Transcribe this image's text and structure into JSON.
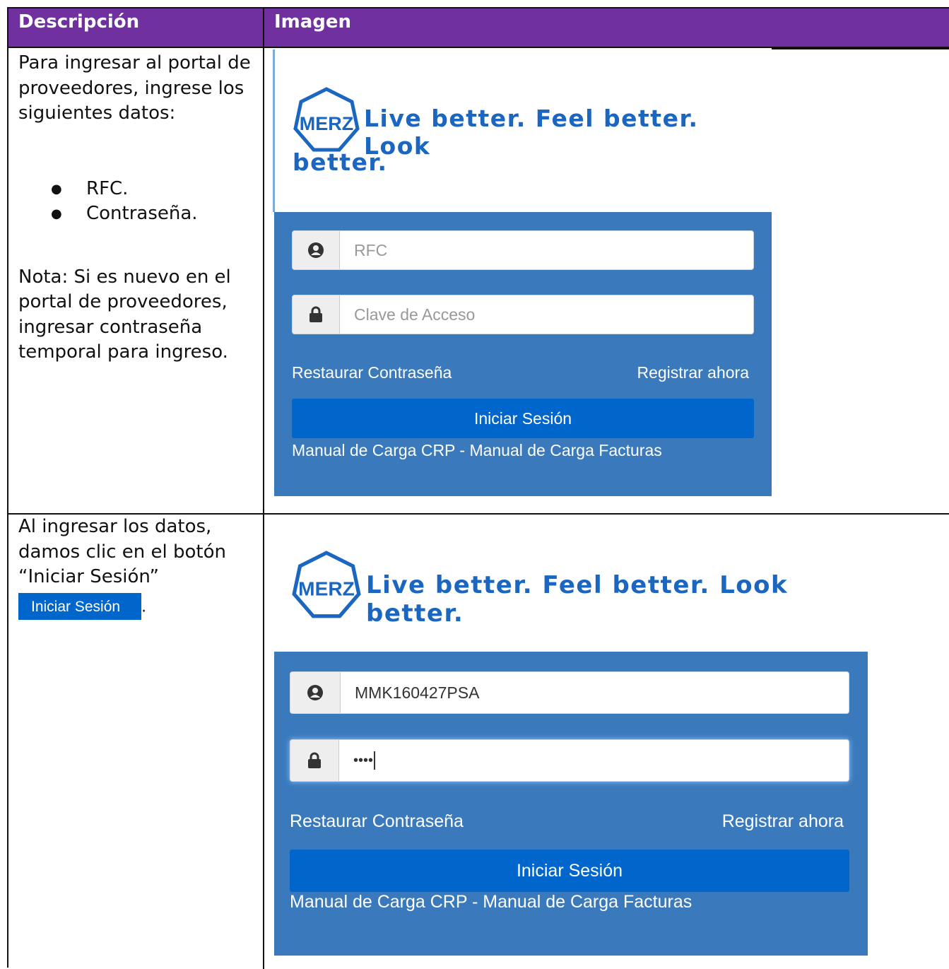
{
  "table": {
    "header_description": "Descripción",
    "header_image": "Imagen"
  },
  "row1": {
    "intro": "Para ingresar al portal de proveedores, ingrese los siguientes datos:",
    "bullets": [
      "RFC.",
      "Contraseña."
    ],
    "note": "Nota: Si es nuevo en el portal de proveedores, ingresar contraseña temporal para ingreso."
  },
  "row2": {
    "text": "Al ingresar los datos, damos clic en el botón “Iniciar Sesión”",
    "inline_button": "Iniciar Sesión",
    "period": "."
  },
  "screenshot1": {
    "logo_text": "MERZ",
    "tagline_line1": "Live better. Feel better. Look",
    "tagline_line2": "better.",
    "rfc_placeholder": "RFC",
    "password_placeholder": "Clave de Acceso",
    "restore_link": "Restaurar Contraseña",
    "register_link": "Registrar ahora",
    "login_button": "Iniciar Sesión",
    "manual_crp": "Manual de Carga CRP",
    "manual_sep": " - ",
    "manual_facturas": "Manual de Carga Facturas"
  },
  "screenshot2": {
    "logo_text": "MERZ",
    "tagline": "Live better. Feel better. Look better.",
    "rfc_value": "MMK160427PSA",
    "password_value": "••••",
    "restore_link": "Restaurar Contraseña",
    "register_link": "Registrar ahora",
    "login_button": "Iniciar Sesión",
    "manual_crp": "Manual de Carga CRP",
    "manual_sep": " - ",
    "manual_facturas": "Manual de Carga Facturas"
  },
  "colors": {
    "header_bg": "#7030a0",
    "panel_bg": "#3a7abc",
    "button_bg": "#0066cc",
    "tagline": "#1a66c0"
  }
}
